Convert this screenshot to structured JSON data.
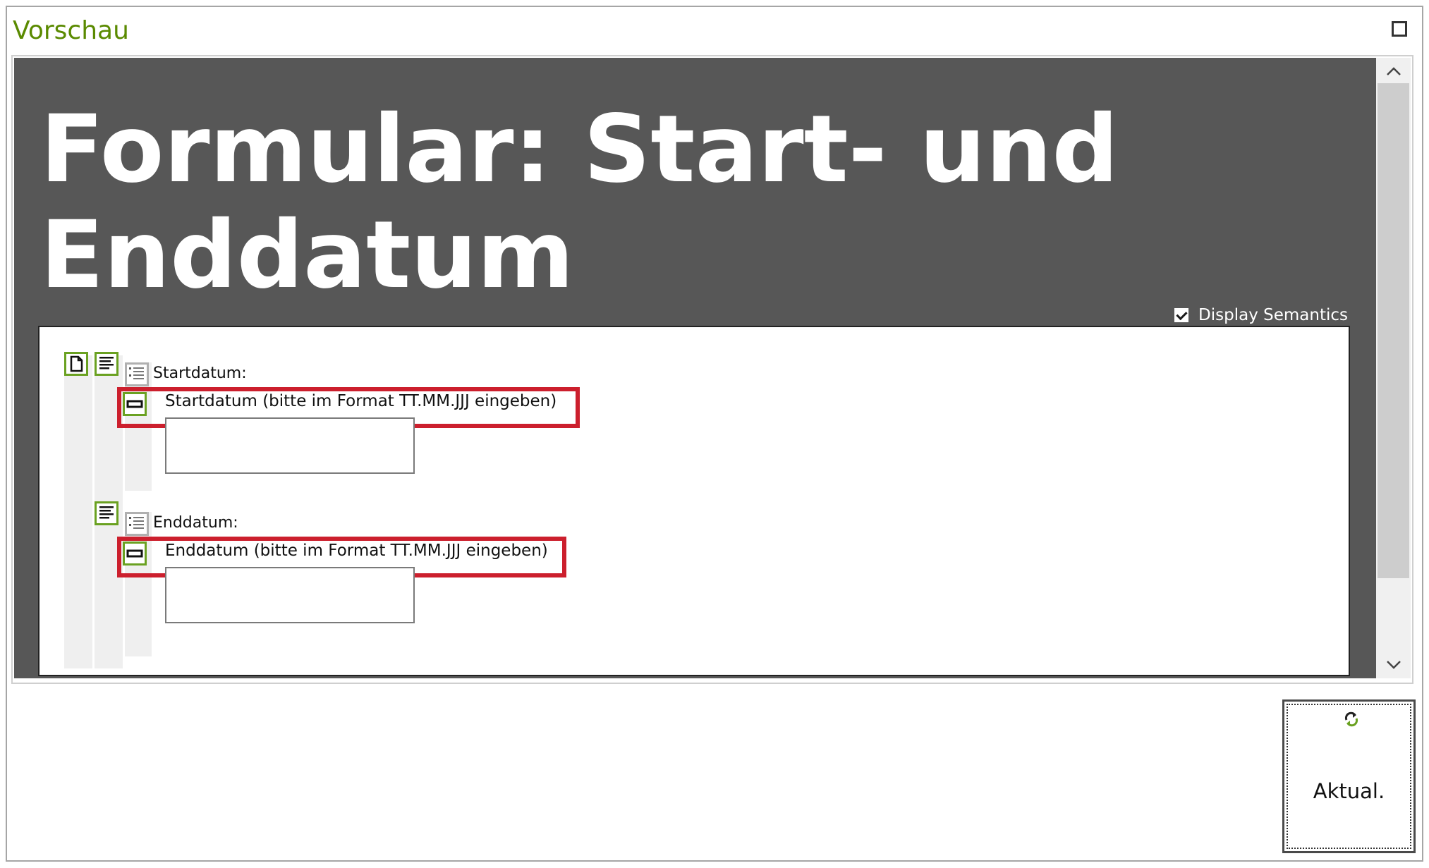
{
  "window": {
    "title": "Vorschau"
  },
  "preview": {
    "heading": "Formular: Start- und Enddatum",
    "display_semantics": {
      "label": "Display Semantics",
      "checked": true
    },
    "form": {
      "groups": [
        {
          "group_label": "Startdatum:",
          "field_label": "Startdatum (bitte im Format TT.MM.JJJ eingeben)",
          "value": ""
        },
        {
          "group_label": "Enddatum:",
          "field_label": "Enddatum (bitte im Format TT.MM.JJJ eingeben)",
          "value": ""
        }
      ]
    }
  },
  "refresh_button": {
    "label": "Aktual.",
    "icon": "refresh-icon"
  },
  "colors": {
    "title_green": "#5a8a00",
    "semantics_green": "#6aa121",
    "highlight_red": "#cc1f2d",
    "preview_background": "#575757"
  }
}
